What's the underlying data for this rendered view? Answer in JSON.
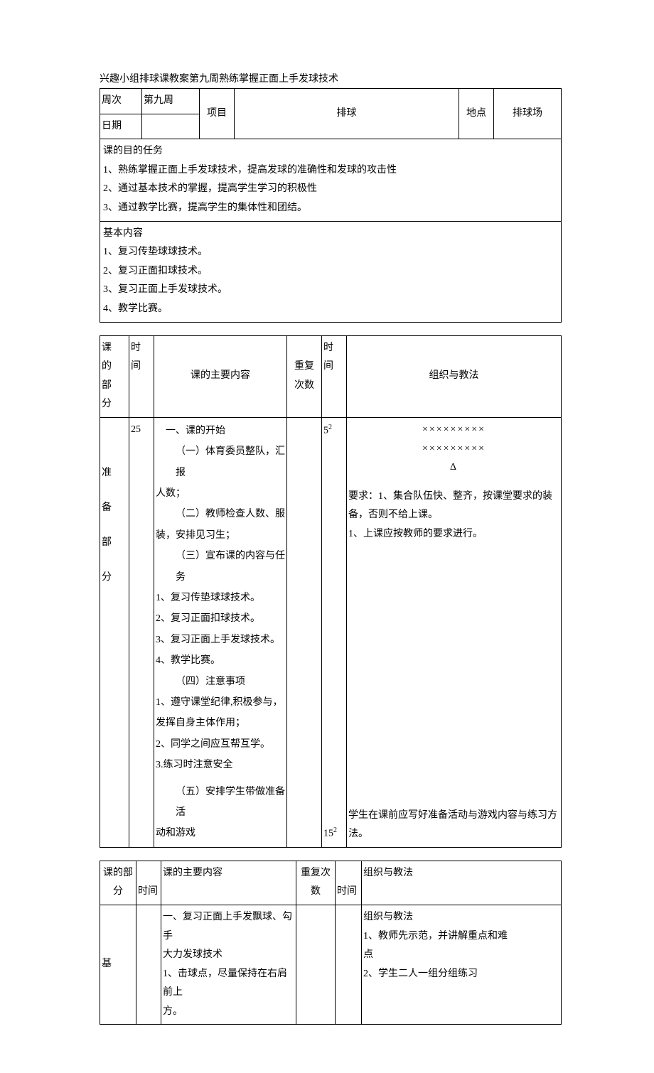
{
  "title": "兴趣小组排球课教案第九周熟练掌握正面上手发球技术",
  "table1": {
    "week_label": "周次",
    "week_value": "第九周",
    "date_label": "日期",
    "project_label": "项目",
    "project_value": "排球",
    "location_label": "地点",
    "location_value": "排球场",
    "purpose_header": "课的目的任务",
    "purpose_1": "1、熟练掌握正面上手发球技术，提高发球的准确性和发球的攻击性",
    "purpose_2": "2、通过基本技术的掌握，提高学生学习的积极性",
    "purpose_3": "3、通过教学比赛，提高学生的集体性和团结。",
    "basic_header": "基本内容",
    "basic_1": "1、复习传垫球球技术。",
    "basic_2": "2、复习正面扣球技术。",
    "basic_3": "3、复习正面上手发球技术。",
    "basic_4": "4、教学比赛。"
  },
  "table2": {
    "h_part1": "课",
    "h_part2": "的",
    "h_part3": "部",
    "h_part4": "分",
    "h_time1": "时",
    "h_time2": "间",
    "h_content": "课的主要内容",
    "h_rep1": "重复",
    "h_rep2": "次数",
    "h_dur1": "时",
    "h_dur2": "间",
    "h_org": "组织与教法",
    "prep1": "准",
    "prep2": "备",
    "prep3": "部",
    "prep4": "分",
    "time_val": "25",
    "c_1": "一、课的开始",
    "c_2": "（一）体育委员整队，汇报",
    "c_3": "人数；",
    "c_4": "（二）教师检查人数、服",
    "c_5": "装，安排见习生；",
    "c_6": "（三）宣布课的内容与任务",
    "c_7": "1、复习传垫球球技术。",
    "c_8": "2、复习正面扣球技术。",
    "c_9": "3、复习正面上手发球技术。",
    "c_10": "4、教学比赛。",
    "c_11": "（四）注意事项",
    "c_12": "1、遵守课堂纪律,积极参与，",
    "c_13": "发挥自身主体作用；",
    "c_14": "2、同学之间应互帮互学。",
    "c_15": "3.练习时注意安全",
    "c_16": "（五）安排学生带做准备活",
    "c_17": "动和游戏",
    "dur_1": "5",
    "dur_1s": "2",
    "dur_2": "15",
    "dur_2s": "2",
    "org_x1": "×××××××××",
    "org_x2": "×××××××××",
    "org_tri": "Δ",
    "org_r1": "要求：1、集合队伍快、整齐，按课堂要求的装备，否则不给上课。",
    "org_r2": "1、上课应按教师的要求进行。",
    "org_bottom": "学生在课前应写好准备活动与游戏内容与练习方法。"
  },
  "table3": {
    "h_part1": "课的部",
    "h_part2": "分",
    "h_time": "时间",
    "h_content": "课的主要内容",
    "h_rep1": "重复次",
    "h_rep2": "数",
    "h_dur": "时间",
    "h_org": "组织与教法",
    "base": "基",
    "c_1": "一、复习正面上手发飘球、勾手",
    "c_2": "大力发球技术",
    "c_3": "1、击球点，尽量保持在右肩前上",
    "c_4": "方。",
    "o_1": "组织与教法",
    "o_2": "1、教师先示范，并讲解重点和难",
    "o_3": "点",
    "o_4": "2、学生二人一组分组练习"
  }
}
